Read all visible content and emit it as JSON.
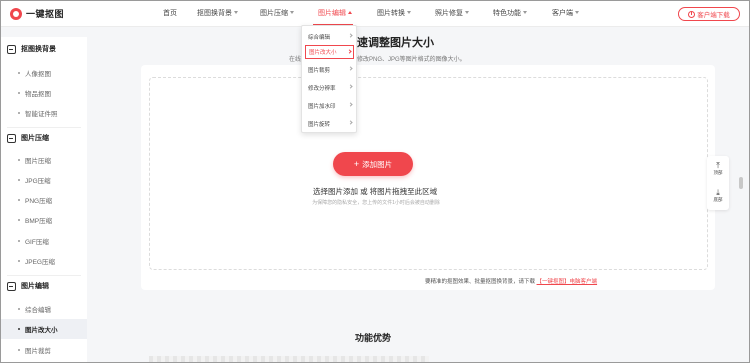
{
  "app": {
    "logo_text": "一键抠图"
  },
  "nav": {
    "items": [
      {
        "label": "首页",
        "has_caret": false,
        "active": false
      },
      {
        "label": "抠图换背景",
        "has_caret": true,
        "active": false
      },
      {
        "label": "图片压缩",
        "has_caret": true,
        "active": false
      },
      {
        "label": "图片编辑",
        "has_caret": true,
        "active": true
      },
      {
        "label": "图片转换",
        "has_caret": true,
        "active": false
      },
      {
        "label": "照片修复",
        "has_caret": true,
        "active": false
      },
      {
        "label": "特色功能",
        "has_caret": true,
        "active": false
      },
      {
        "label": "客户端",
        "has_caret": true,
        "active": false
      }
    ],
    "download_label": "客户端下载"
  },
  "dropdown": {
    "items": [
      {
        "label": "综合编辑",
        "active": false
      },
      {
        "label": "图片改大小",
        "active": true
      },
      {
        "label": "图片裁剪",
        "active": false
      },
      {
        "label": "修改分辨率",
        "active": false
      },
      {
        "label": "图片加水印",
        "active": false
      },
      {
        "label": "图片旋转",
        "active": false
      }
    ]
  },
  "sidebar": {
    "sections": [
      {
        "title": "抠图换背景",
        "items": [
          "人像抠图",
          "物品抠图",
          "智能证件照"
        ]
      },
      {
        "title": "图片压缩",
        "items": [
          "图片压缩",
          "JPG压缩",
          "PNG压缩",
          "BMP压缩",
          "GIF压缩",
          "JPEG压缩"
        ]
      },
      {
        "title": "图片编辑",
        "items": [
          "综合编辑",
          "图片改大小",
          "图片裁剪"
        ]
      }
    ],
    "active_item": "图片改大小"
  },
  "main": {
    "title": "速调整图片大小",
    "subtitle_left": "在线",
    "subtitle": "修改PNG、JPG等图片格式的图像大小。",
    "add_button": "添加图片",
    "drop_hint": "选择图片添加 或 将图片拖拽至此区域",
    "privacy": "为保障您的隐私安全，您上传的文件1小时后会被自动删除",
    "footnote_prefix": "要精准的抠图效果、批量抠图换背景，请下载",
    "footnote_link": "【一键抠图】电脑客户端",
    "features_title": "功能优势"
  },
  "floatbar": {
    "top_label": "顶部",
    "bottom_label": "底部"
  },
  "colors": {
    "accent": "#f0474d"
  }
}
